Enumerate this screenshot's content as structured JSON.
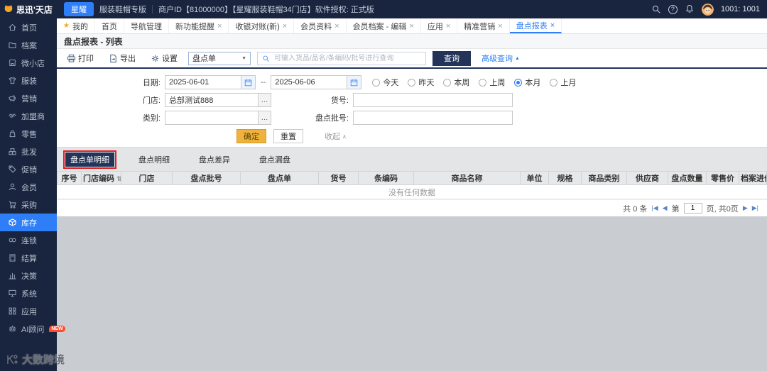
{
  "colors": {
    "accent": "#2e7ef7",
    "dark_navy": "#19253e",
    "annotation_red": "#e02020",
    "confirm_yellow": "#eeb23d"
  },
  "icons": {
    "star": "★",
    "close": "×",
    "caret_down": "▼",
    "triangle_up": "▲",
    "collapse_up": "∧",
    "ellipsis": "…",
    "sort": "⇅",
    "question": "?",
    "first_page": "|◀",
    "prev_page": "◀",
    "next_page": "▶",
    "last_page": "▶|"
  },
  "app": {
    "logo_text": "思迅'天店",
    "watermark": "大数跨境"
  },
  "topbar": {
    "edition_button": "星耀",
    "edition_name": "服装鞋帽专版",
    "merchant_info": "商户ID【81000000】【星耀服装鞋帽34门店】软件授权: 正式版",
    "user_label": "1001: 1001"
  },
  "tabbar": {
    "tabs": [
      {
        "label": "我的"
      },
      {
        "label": "首页"
      },
      {
        "label": "导航管理"
      },
      {
        "label": "新功能提醒"
      },
      {
        "label": "收银对账(新)"
      },
      {
        "label": "会员资料"
      },
      {
        "label": "会员档案 - 编辑"
      },
      {
        "label": "应用"
      },
      {
        "label": "精准营销"
      },
      {
        "label": "盘点报表"
      }
    ]
  },
  "sidebar": {
    "items": [
      {
        "label": "首页"
      },
      {
        "label": "档案"
      },
      {
        "label": "微小店"
      },
      {
        "label": "服装"
      },
      {
        "label": "营销"
      },
      {
        "label": "加盟商"
      },
      {
        "label": "零售"
      },
      {
        "label": "批发"
      },
      {
        "label": "促销"
      },
      {
        "label": "会员"
      },
      {
        "label": "采购"
      },
      {
        "label": "库存"
      },
      {
        "label": "连锁"
      },
      {
        "label": "结算"
      },
      {
        "label": "决策"
      },
      {
        "label": "系统"
      },
      {
        "label": "应用"
      },
      {
        "label": "AI顾问",
        "badge": "NEW"
      }
    ]
  },
  "page": {
    "title": "盘点报表 - 列表"
  },
  "toolbar": {
    "print": "打印",
    "export": "导出",
    "settings": "设置",
    "doc_type_select": "盘点单",
    "search_placeholder": "可输入货品/品名/条编码/批号进行查询",
    "query_button": "查询",
    "advanced_query": "高级查询"
  },
  "filters": {
    "date_label": "日期:",
    "date_from": "2025-06-01",
    "date_separator": "--",
    "date_to": "2025-06-06",
    "quick_ranges": [
      {
        "label": "今天"
      },
      {
        "label": "昨天"
      },
      {
        "label": "本周"
      },
      {
        "label": "上周"
      },
      {
        "label": "本月"
      },
      {
        "label": "上月"
      }
    ],
    "store_label": "门店:",
    "store_value": "总部测试888",
    "item_no_label": "货号:",
    "category_label": "类别:",
    "batch_label": "盘点批号:",
    "confirm_button": "确定",
    "reset_button": "重置",
    "collapse": "收起"
  },
  "detail_tabs": [
    {
      "label": "盘点单明细"
    },
    {
      "label": "盘点明细"
    },
    {
      "label": "盘点差异"
    },
    {
      "label": "盘点漏盘"
    }
  ],
  "table": {
    "columns": [
      "序号",
      "门店编码",
      "门店",
      "盘点批号",
      "盘点单",
      "货号",
      "条编码",
      "商品名称",
      "单位",
      "规格",
      "商品类别",
      "供应商",
      "盘点数量",
      "零售价",
      "档案进价"
    ],
    "empty_text": "没有任何数据"
  },
  "pagination": {
    "total_text": "共 0 条",
    "page_prefix": "第",
    "current_page": "1",
    "page_suffix": "页, 共0页"
  }
}
